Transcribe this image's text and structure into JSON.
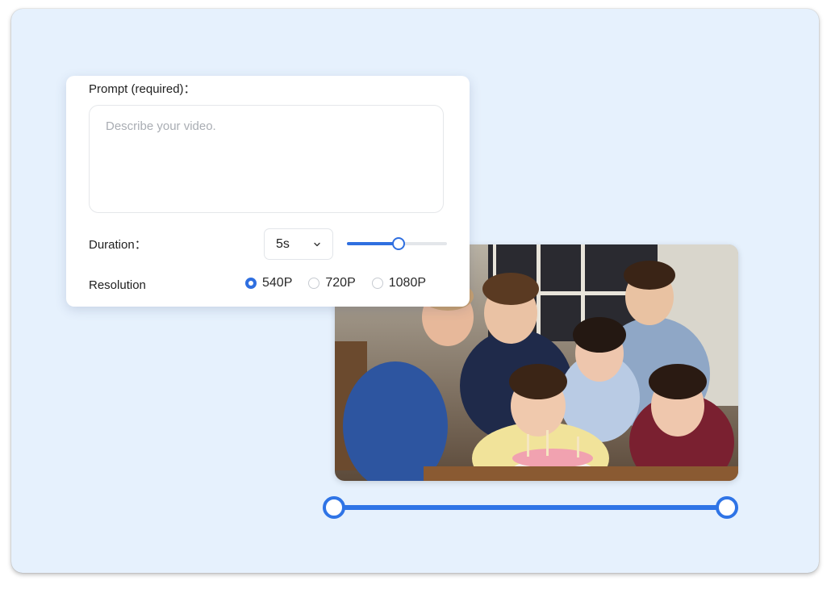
{
  "panel": {
    "prompt_label": "Prompt (required)：",
    "prompt_placeholder": "Describe your video.",
    "prompt_value": "",
    "duration_label": "Duration：",
    "duration_value": "5s",
    "duration_slider_fraction": 0.52,
    "resolution_label": "Resolution",
    "resolution_options": [
      {
        "label": "540P",
        "selected": true
      },
      {
        "label": "720P",
        "selected": false
      },
      {
        "label": "1080P",
        "selected": false
      }
    ]
  },
  "trim": {
    "start_fraction": 0,
    "end_fraction": 1
  },
  "colors": {
    "accent": "#2f6fe0",
    "background": "#e6f1fd"
  },
  "icons": {
    "duration_dropdown": "chevron-down-icon"
  }
}
